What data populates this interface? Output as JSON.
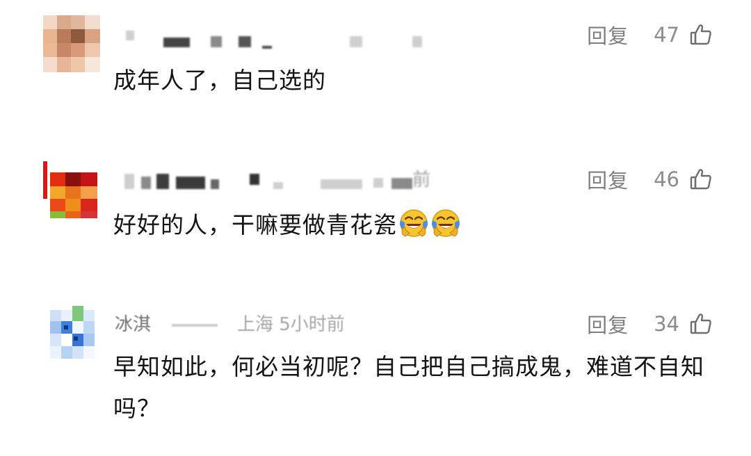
{
  "comments": [
    {
      "username": "",
      "meta": "",
      "reply_label": "回复",
      "likes": "47",
      "text": "成年人了，自己选的",
      "emojis": []
    },
    {
      "username": "",
      "meta": "前",
      "reply_label": "回复",
      "likes": "46",
      "text": "好好的人，干嘛要做青花瓷",
      "emojis": [
        "face-with-tears-of-joy",
        "face-with-tears-of-joy"
      ]
    },
    {
      "username": "冰淇",
      "meta": "上海 5小时前",
      "reply_label": "回复",
      "likes": "34",
      "text": "早知如此，何必当初呢？自己把自己搞成鬼，难道不自知吗？",
      "emojis": []
    }
  ],
  "icons": {
    "like": "thumb-up-icon",
    "emoji": "laughing-crying-emoji"
  },
  "colors": {
    "text": "#141414",
    "muted": "#8c8c8c",
    "emoji_yellow": "#f7c531",
    "emoji_blue": "#4a8fe7"
  }
}
